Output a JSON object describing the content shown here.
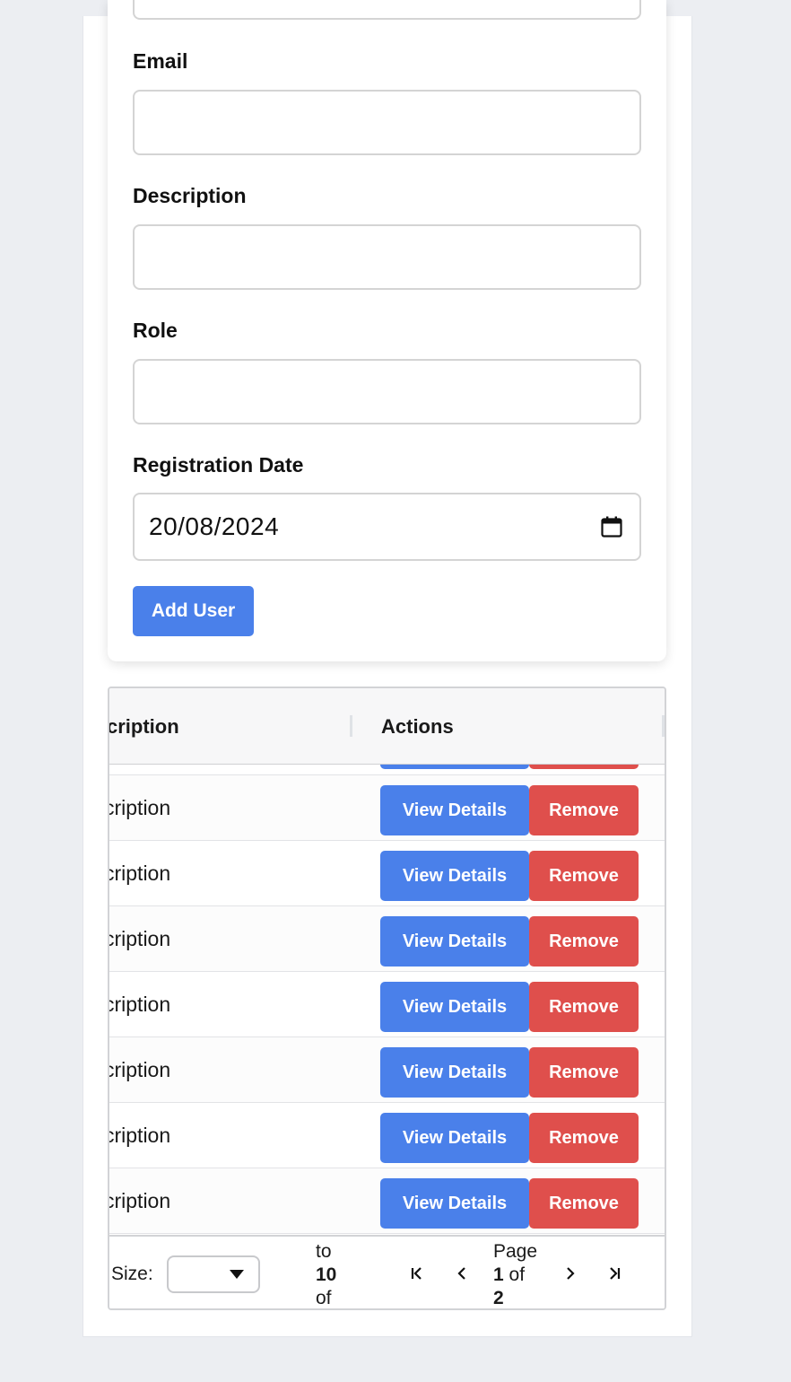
{
  "form": {
    "email_label": "Email",
    "email_value": "",
    "description_label": "Description",
    "description_value": "",
    "role_label": "Role",
    "role_value": "",
    "registration_date_label": "Registration Date",
    "registration_date_value": "20/08/2024",
    "add_button_label": "Add User",
    "date_icon": "calendar-icon"
  },
  "table": {
    "columns": [
      {
        "label": "cription"
      },
      {
        "label": "Actions"
      }
    ],
    "rows": [
      {
        "description": "cription",
        "view_label": "View Details",
        "remove_label": "Remove"
      },
      {
        "description": "cription",
        "view_label": "View Details",
        "remove_label": "Remove"
      },
      {
        "description": "cription",
        "view_label": "View Details",
        "remove_label": "Remove"
      },
      {
        "description": "cription",
        "view_label": "View Details",
        "remove_label": "Remove"
      },
      {
        "description": "cription",
        "view_label": "View Details",
        "remove_label": "Remove"
      },
      {
        "description": "cription",
        "view_label": "View Details",
        "remove_label": "Remove"
      },
      {
        "description": "cription",
        "view_label": "View Details",
        "remove_label": "Remove"
      }
    ]
  },
  "pagination": {
    "size_label": "Size:",
    "size_value": "",
    "range_to": "to",
    "range_end": "10",
    "range_of": "of",
    "page_label": "Page",
    "page_current": "1",
    "page_of": "of",
    "page_total": "2",
    "icons": [
      "first-page-icon",
      "previous-page-icon",
      "next-page-icon",
      "last-page-icon"
    ]
  },
  "colors": {
    "primary_button": "#4a80ea",
    "danger_button": "#df4f4c",
    "page_background": "#eceef2"
  }
}
